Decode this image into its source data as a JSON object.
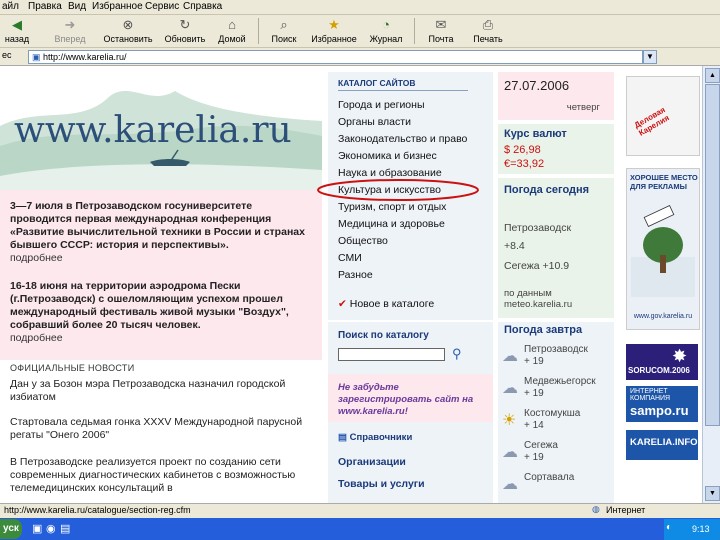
{
  "menu": [
    "айл",
    "Правка",
    "Вид",
    "Избранное",
    "Сервис",
    "Справка"
  ],
  "toolbar": {
    "back": "назад",
    "forward": "Вперед",
    "stop": "Остановить",
    "refresh": "Обновить",
    "home": "Домой",
    "search": "Поиск",
    "favorites": "Избранное",
    "history": "Журнал",
    "mail": "Почта",
    "print": "Печать"
  },
  "address": {
    "label": "ес",
    "value": "http://www.karelia.ru/"
  },
  "logo": {
    "text": "www.karelia.ru"
  },
  "news": [
    {
      "bold": "3—7 июля в Петрозаводском госуниверситете проводится первая международная конференция «Развитие вычислительной техники в России и странах бывшего СССР: история и перспективы».",
      "more": "подробнее"
    },
    {
      "bold": "16-18 июня на территории аэродрома Пески (г.Петрозаводск) с ошеломляющим успехом прошел международный фестиваль живой музыки \"Воздух\", собравший более 20 тысяч человек.",
      "more": "подробнее"
    }
  ],
  "official": {
    "heading": "ОФИЦИАЛЬНЫЕ НОВОСТИ",
    "items": [
      "Дан у за Бозон мэра Петрозаводска назначил городской избиатом",
      "Стартовала седьмая гонка XXXV Международной парусной регаты \"Онего 2006\"",
      "В Петрозаводске реализуется проект по созданию сети современных диагностических кабинетов с возможностью телемедицинских консультаций в"
    ]
  },
  "catalog": {
    "heading": "КАТАЛОГ САЙТОВ",
    "items": [
      "Города и регионы",
      "Органы власти",
      "Законодательство и право",
      "Экономика и бизнес",
      "Наука и образование",
      "Культура и искусство",
      "Туризм, спорт и отдых",
      "Медицина и здоровье",
      "Общество",
      "СМИ",
      "Разное"
    ],
    "new_label": "Новое в каталоге",
    "search_heading": "Поиск по каталогу",
    "search_placeholder": "",
    "register_text": "Не забудьте зарегистрировать сайт на www.karelia.ru!",
    "spr_heading": "Справочники",
    "links": [
      "Организации",
      "Товары и услуги"
    ]
  },
  "info": {
    "date": "27.07.2006",
    "weekday": "четверг",
    "currency_heading": "Курс валют",
    "usd": "$ 26,98",
    "eur": "€=33,92",
    "weather_heading": "Погода сегодня",
    "weather_city": "Петрозаводск",
    "weather_temp": "+8.4",
    "weather_forecast": "Сегежа +10.9",
    "weather_source": "по данным meteo.karelia.ru",
    "tomorrow_heading": "Погода завтра",
    "tomorrow": [
      {
        "city": "Петрозаводск",
        "temp": "+ 19"
      },
      {
        "city": "Медвежьегорск",
        "temp": "+ 19"
      },
      {
        "city": "Костомукша",
        "temp": "+ 14"
      },
      {
        "city": "Сегежа",
        "temp": "+ 19"
      },
      {
        "city": "Сортавала",
        "temp": ""
      }
    ]
  },
  "ads": {
    "ad1": "Деловая Карелия",
    "ad2_title": "ХОРОШЕЕ МЕСТО ДЛЯ РЕКЛАМЫ",
    "ad2_sub": "www.gov.karelia.ru",
    "ad3": "SORUCOM.2006",
    "ad4_small": "интернет компания",
    "ad4": "sampo.ru",
    "ad5": "KARELIA.INFO"
  },
  "status": {
    "url": "http://www.karelia.ru/catalogue/section-reg.cfm",
    "zone": "Интернет"
  },
  "taskbar": {
    "start": "уск",
    "time": "9:13"
  },
  "colors": {
    "pink": "#fde8ee",
    "title_blue": "#1a3a7a",
    "accent_red": "#cc1111",
    "chrome": "#ece9d8"
  }
}
